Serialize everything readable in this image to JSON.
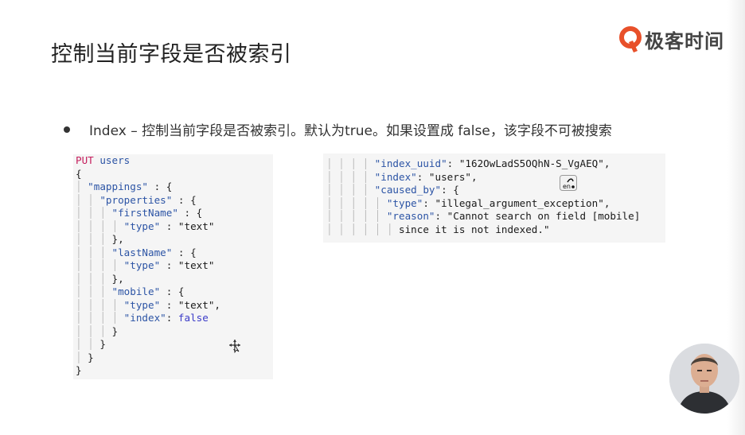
{
  "title": "控制当前字段是否被索引",
  "brand": {
    "name": "极客时间",
    "color": "#e8502a"
  },
  "bullet": {
    "text": "Index – 控制当前字段是否被索引。默认为true。如果设置成   false，该字段不可被搜索"
  },
  "left_code": {
    "method": "PUT",
    "target": " users",
    "lines": [
      [
        "{"
      ],
      [
        "  ",
        "\"mappings\"",
        " : {"
      ],
      [
        "    ",
        "\"properties\"",
        " : {"
      ],
      [
        "      ",
        "\"firstName\"",
        " : {"
      ],
      [
        "        ",
        "\"type\"",
        " : ",
        "\"text\""
      ],
      [
        "      ",
        "},"
      ],
      [
        "      ",
        "\"lastName\"",
        " : {"
      ],
      [
        "        ",
        "\"type\"",
        " : ",
        "\"text\""
      ],
      [
        "      ",
        "},"
      ],
      [
        "      ",
        "\"mobile\"",
        " : {"
      ],
      [
        "        ",
        "\"type\"",
        " : ",
        "\"text\"",
        ","
      ],
      [
        "        ",
        "\"index\"",
        ":",
        " false"
      ],
      [
        "      ",
        "}"
      ],
      [
        "    ",
        "}"
      ],
      [
        "  ",
        "}"
      ],
      [
        "}"
      ]
    ]
  },
  "right_code": {
    "lines": [
      [
        "        ",
        "\"index_uuid\"",
        ": ",
        "\"162OwLadS5OQhN-S_VgAEQ\"",
        ","
      ],
      [
        "        ",
        "\"index\"",
        ": ",
        "\"users\"",
        ","
      ],
      [
        "        ",
        "\"caused_by\"",
        ": {"
      ],
      [
        "          ",
        "\"type\"",
        ": ",
        "\"illegal_argument_exception\"",
        ","
      ],
      [
        "          ",
        "\"reason\"",
        ": ",
        "\"Cannot search on field [mobile]"
      ],
      [
        "            ",
        "since it is not indexed.\""
      ]
    ]
  },
  "icons": {
    "cursor": "move-cursor-icon",
    "ime": "input-method-icon",
    "logo": "geektime-logo-icon"
  }
}
